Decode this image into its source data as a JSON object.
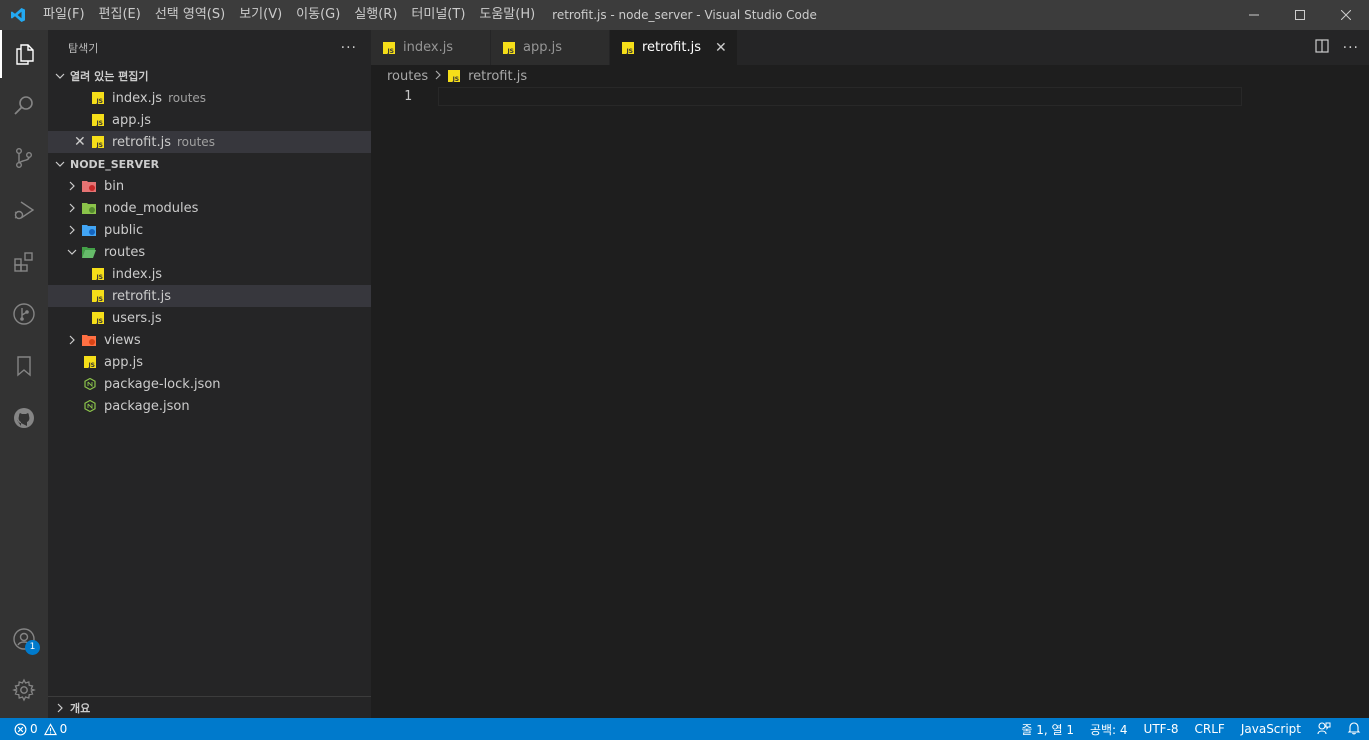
{
  "titlebar": {
    "title": "retrofit.js - node_server - Visual Studio Code",
    "menu": [
      "파일(F)",
      "편집(E)",
      "선택 영역(S)",
      "보기(V)",
      "이동(G)",
      "실행(R)",
      "터미널(T)",
      "도움말(H)"
    ]
  },
  "activitybar": {
    "accounts_badge": "1"
  },
  "sidebar": {
    "title": "탐색기",
    "more": "···",
    "open_editors": {
      "label": "열려 있는 편집기",
      "items": [
        {
          "name": "index.js",
          "desc": "routes"
        },
        {
          "name": "app.js",
          "desc": ""
        },
        {
          "name": "retrofit.js",
          "desc": "routes"
        }
      ]
    },
    "workspace": {
      "label": "NODE_SERVER",
      "items": [
        "bin",
        "node_modules",
        "public",
        "routes",
        "index.js",
        "retrofit.js",
        "users.js",
        "views",
        "app.js",
        "package-lock.json",
        "package.json"
      ]
    },
    "outline_label": "개요"
  },
  "editor": {
    "tabs": [
      "index.js",
      "app.js",
      "retrofit.js"
    ],
    "breadcrumb": [
      "routes",
      "retrofit.js"
    ],
    "line_number": "1"
  },
  "statusbar": {
    "errors": "0",
    "warnings": "0",
    "position": "줄 1, 열 1",
    "spaces": "공백: 4",
    "encoding": "UTF-8",
    "eol": "CRLF",
    "language": "JavaScript"
  },
  "colors": {
    "accent": "#007acc",
    "js_icon": "#f5de19"
  }
}
